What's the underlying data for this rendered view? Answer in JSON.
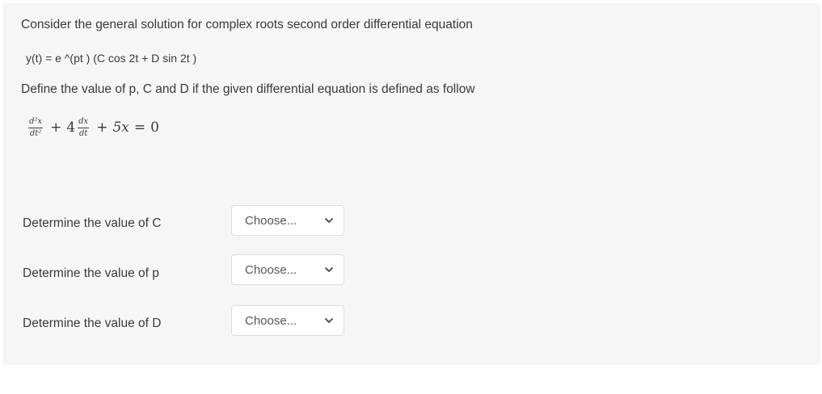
{
  "question": {
    "line1": "Consider the general solution for complex roots second order differential equation",
    "line2": "y(t) = e ^(pt ) (C cos 2t + D sin 2t )",
    "line3": "Define the value of p, C and D if the given differential equation is defined as follow"
  },
  "equation": {
    "frac1_num": "d²x",
    "frac1_den": "dt²",
    "op1": "+",
    "coef2": "4",
    "frac2_num": "dx",
    "frac2_den": "dt",
    "op2": "+",
    "term3": "5x",
    "eq": "=",
    "rhs": "0"
  },
  "rows": [
    {
      "label": "Determine the value of C",
      "select_value": "Choose..."
    },
    {
      "label": "Determine the value of p",
      "select_value": "Choose..."
    },
    {
      "label": "Determine the value of D",
      "select_value": "Choose..."
    }
  ],
  "colors": {
    "panel_bg": "#f6f6f6",
    "text": "#3a3a3a",
    "select_border": "#dddddd"
  }
}
